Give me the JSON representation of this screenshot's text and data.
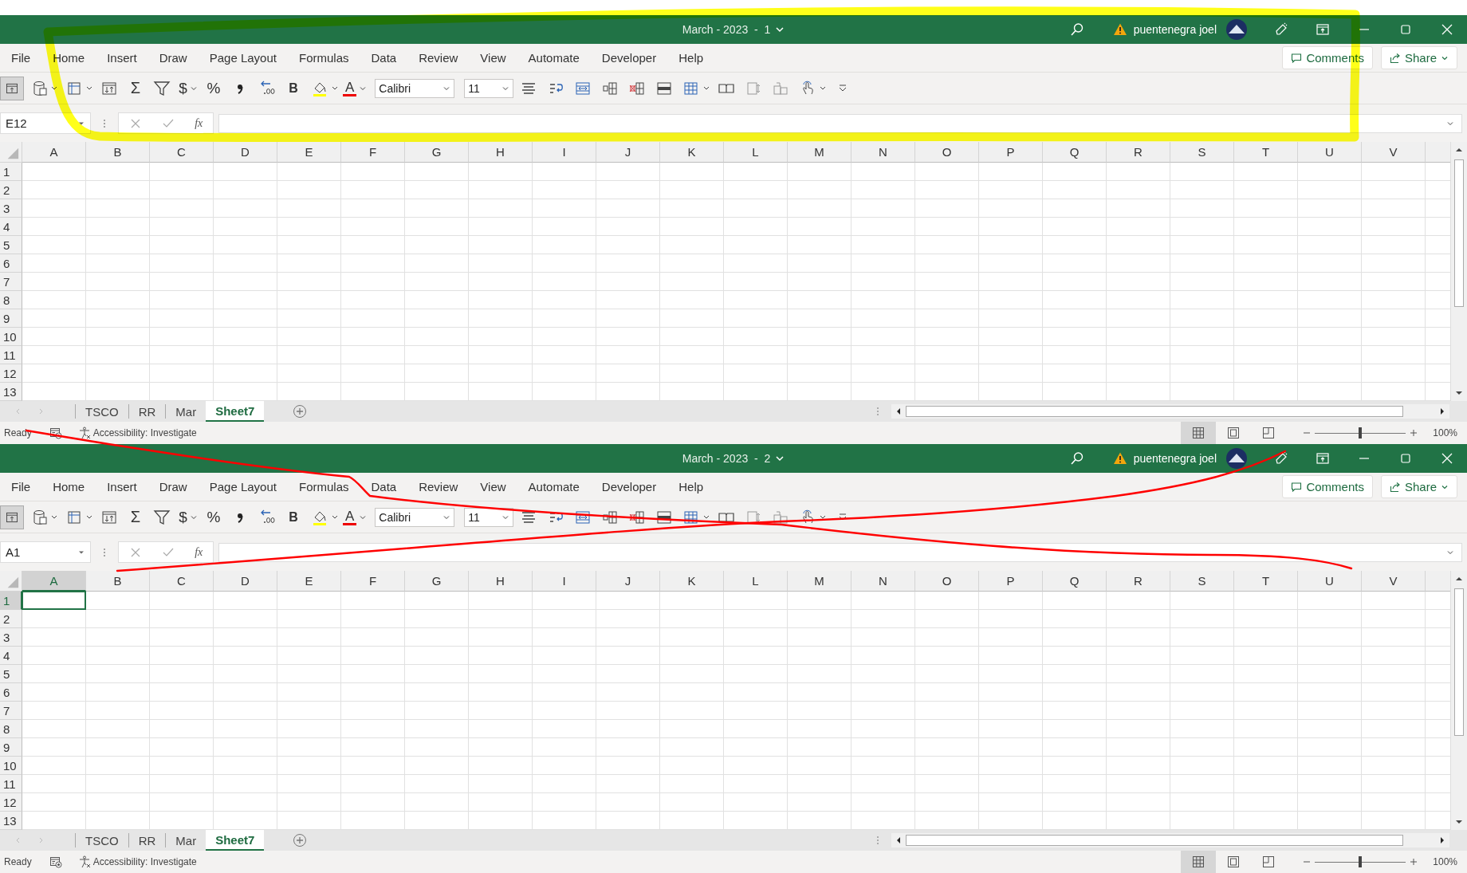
{
  "windows": [
    {
      "title": "March - 2023  -  1",
      "user": "puentenegra joel",
      "menu": [
        "File",
        "Home",
        "Insert",
        "Draw",
        "Page Layout",
        "Formulas",
        "Data",
        "Review",
        "View",
        "Automate",
        "Developer",
        "Help"
      ],
      "comments": "Comments",
      "share": "Share",
      "toolbar_glyphs": [
        "Σ",
        "$",
        "%",
        "B",
        "A"
      ],
      "font": "Calibri",
      "font_size": "11",
      "name_box": "E12",
      "fx": "fx",
      "columns": [
        {
          "label": "A",
          "selected": false
        },
        {
          "label": "B",
          "selected": false
        },
        {
          "label": "C",
          "selected": false
        },
        {
          "label": "D",
          "selected": false
        },
        {
          "label": "E",
          "selected": false
        },
        {
          "label": "F",
          "selected": false
        },
        {
          "label": "G",
          "selected": false
        },
        {
          "label": "H",
          "selected": false
        },
        {
          "label": "I",
          "selected": false
        },
        {
          "label": "J",
          "selected": false
        },
        {
          "label": "K",
          "selected": false
        },
        {
          "label": "L",
          "selected": false
        },
        {
          "label": "M",
          "selected": false
        },
        {
          "label": "N",
          "selected": false
        },
        {
          "label": "O",
          "selected": false
        },
        {
          "label": "P",
          "selected": false
        },
        {
          "label": "Q",
          "selected": false
        },
        {
          "label": "R",
          "selected": false
        },
        {
          "label": "S",
          "selected": false
        },
        {
          "label": "T",
          "selected": false
        },
        {
          "label": "U",
          "selected": false
        },
        {
          "label": "V",
          "selected": false
        }
      ],
      "rows": [
        {
          "label": "1",
          "selected": false
        },
        {
          "label": "2",
          "selected": false
        },
        {
          "label": "3",
          "selected": false
        },
        {
          "label": "4",
          "selected": false
        },
        {
          "label": "5",
          "selected": false
        },
        {
          "label": "6",
          "selected": false
        },
        {
          "label": "7",
          "selected": false
        },
        {
          "label": "8",
          "selected": false
        },
        {
          "label": "9",
          "selected": false
        },
        {
          "label": "10",
          "selected": false
        },
        {
          "label": "11",
          "selected": false
        },
        {
          "label": "12",
          "selected": false
        },
        {
          "label": "13",
          "selected": false
        }
      ],
      "sheets": [
        {
          "label": "TSCO",
          "selected": false
        },
        {
          "label": "RR",
          "selected": false
        },
        {
          "label": "Mar",
          "selected": false
        },
        {
          "label": "Sheet7",
          "selected": true
        }
      ],
      "status": "Ready",
      "accessibility": "Accessibility: Investigate",
      "views": [
        {
          "selected": true
        },
        {
          "selected": false
        },
        {
          "selected": false
        }
      ],
      "zoom": {
        "level": 0.5,
        "reading": "100%"
      }
    },
    {
      "title": "March - 2023  -  2",
      "user": "puentenegra joel",
      "menu": [
        "File",
        "Home",
        "Insert",
        "Draw",
        "Page Layout",
        "Formulas",
        "Data",
        "Review",
        "View",
        "Automate",
        "Developer",
        "Help"
      ],
      "comments": "Comments",
      "share": "Share",
      "toolbar_glyphs": [
        "Σ",
        "$",
        "%",
        "B",
        "A"
      ],
      "font": "Calibri",
      "font_size": "11",
      "name_box": "A1",
      "fx": "fx",
      "columns": [
        {
          "label": "A",
          "selected": true
        },
        {
          "label": "B",
          "selected": false
        },
        {
          "label": "C",
          "selected": false
        },
        {
          "label": "D",
          "selected": false
        },
        {
          "label": "E",
          "selected": false
        },
        {
          "label": "F",
          "selected": false
        },
        {
          "label": "G",
          "selected": false
        },
        {
          "label": "H",
          "selected": false
        },
        {
          "label": "I",
          "selected": false
        },
        {
          "label": "J",
          "selected": false
        },
        {
          "label": "K",
          "selected": false
        },
        {
          "label": "L",
          "selected": false
        },
        {
          "label": "M",
          "selected": false
        },
        {
          "label": "N",
          "selected": false
        },
        {
          "label": "O",
          "selected": false
        },
        {
          "label": "P",
          "selected": false
        },
        {
          "label": "Q",
          "selected": false
        },
        {
          "label": "R",
          "selected": false
        },
        {
          "label": "S",
          "selected": false
        },
        {
          "label": "T",
          "selected": false
        },
        {
          "label": "U",
          "selected": false
        },
        {
          "label": "V",
          "selected": false
        }
      ],
      "rows": [
        {
          "label": "1",
          "selected": true
        },
        {
          "label": "2",
          "selected": false
        },
        {
          "label": "3",
          "selected": false
        },
        {
          "label": "4",
          "selected": false
        },
        {
          "label": "5",
          "selected": false
        },
        {
          "label": "6",
          "selected": false
        },
        {
          "label": "7",
          "selected": false
        },
        {
          "label": "8",
          "selected": false
        },
        {
          "label": "9",
          "selected": false
        },
        {
          "label": "10",
          "selected": false
        },
        {
          "label": "11",
          "selected": false
        },
        {
          "label": "12",
          "selected": false
        },
        {
          "label": "13",
          "selected": false
        }
      ],
      "sheets": [
        {
          "label": "TSCO",
          "selected": false
        },
        {
          "label": "RR",
          "selected": false
        },
        {
          "label": "Mar",
          "selected": false
        },
        {
          "label": "Sheet7",
          "selected": true
        }
      ],
      "status": "Ready",
      "accessibility": "Accessibility: Investigate",
      "views": [
        {
          "selected": true
        },
        {
          "selected": false
        },
        {
          "selected": false
        }
      ],
      "zoom": {
        "level": 0.5,
        "reading": "100%"
      }
    }
  ],
  "annotations": [
    {
      "kind": "highlighter",
      "color": "#ffff00"
    },
    {
      "kind": "pen",
      "color": "#ff0000"
    },
    {
      "kind": "pen",
      "color": "#ff0000"
    }
  ]
}
